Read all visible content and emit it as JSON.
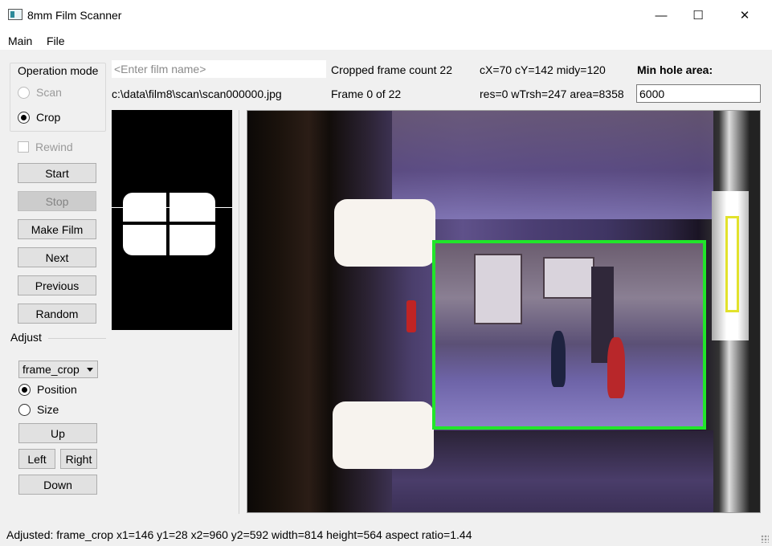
{
  "window": {
    "title": "8mm Film Scanner",
    "minimize_glyph": "—",
    "maximize_glyph": "☐",
    "close_glyph": "✕"
  },
  "menu": {
    "items": [
      "Main",
      "File"
    ]
  },
  "operation_mode": {
    "title": "Operation mode",
    "options": [
      {
        "label": "Scan",
        "checked": false,
        "enabled": false
      },
      {
        "label": "Crop",
        "checked": true,
        "enabled": true
      }
    ]
  },
  "rewind": {
    "label": "Rewind",
    "checked": false,
    "enabled": false
  },
  "buttons": {
    "start": "Start",
    "stop": "Stop",
    "make_film": "Make Film",
    "next": "Next",
    "previous": "Previous",
    "random": "Random"
  },
  "adjust": {
    "title": "Adjust",
    "target_selected": "frame_crop",
    "mode_options": [
      {
        "label": "Position",
        "checked": true
      },
      {
        "label": "Size",
        "checked": false
      }
    ],
    "up": "Up",
    "left": "Left",
    "right": "Right",
    "down": "Down"
  },
  "header": {
    "film_name_value": "",
    "film_name_placeholder": "<Enter film name>",
    "file_path": "c:\\data\\film8\\scan\\scan000000.jpg",
    "cropped_frame_count": "Cropped frame count 22",
    "frame_position": "Frame 0 of 22",
    "centers": "cX=70 cY=142 midy=120",
    "threshold_info": "res=0 wTrsh=247 area=8358",
    "min_hole_area_label": "Min hole area:",
    "min_hole_area_value": "6000"
  },
  "colors": {
    "crop_box": "#21e52a",
    "hole_box": "#e2e22c",
    "disabled_button": "#cccccc",
    "button": "#e1e1e1"
  },
  "status": {
    "text": "Adjusted: frame_crop x1=146 y1=28  x2=960 y2=592 width=814 height=564 aspect ratio=1.44"
  }
}
